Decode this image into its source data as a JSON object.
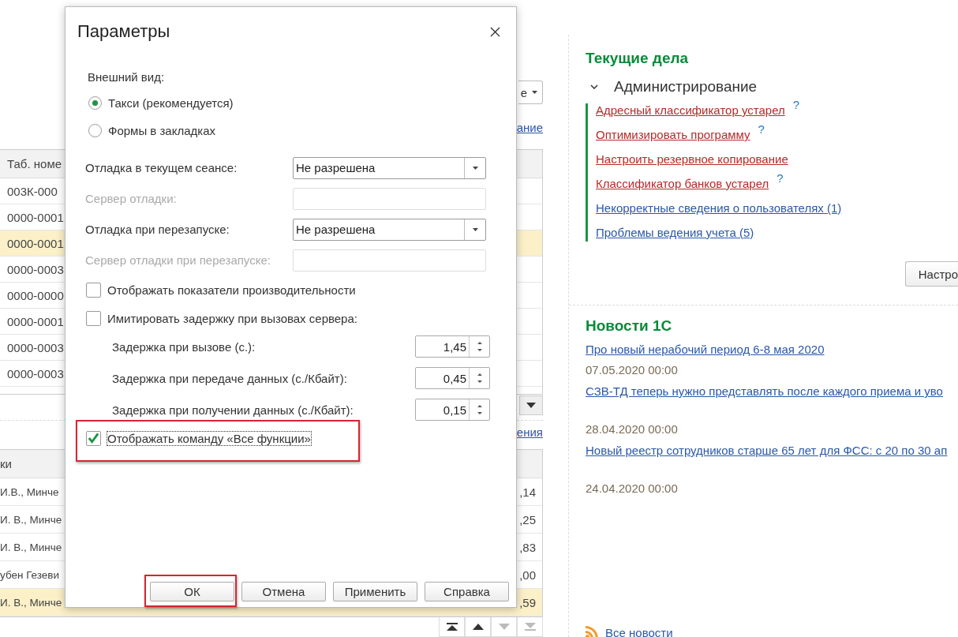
{
  "background": {
    "dropdown_fragment": "е",
    "link_fragment_top": "ание",
    "table_1": {
      "header": "Таб. номе",
      "rows": [
        {
          "cell": "003К-000",
          "selected": false
        },
        {
          "cell": "0000-0001",
          "selected": false
        },
        {
          "cell": "0000-0001",
          "selected": true
        },
        {
          "cell": "0000-0003",
          "selected": false
        },
        {
          "cell": "0000-0000",
          "selected": false
        },
        {
          "cell": "0000-0001",
          "selected": false
        },
        {
          "cell": "0000-0003",
          "selected": false
        },
        {
          "cell": "0000-0003",
          "selected": false
        }
      ]
    },
    "link_fragment_bottom": "ения",
    "table_2": {
      "header": "ки",
      "rows": [
        {
          "cell": "И.В., Минче",
          "amount": ",14",
          "selected": false
        },
        {
          "cell": "И. В., Минче",
          "amount": ",25",
          "selected": false
        },
        {
          "cell": "И. В., Минче",
          "amount": ",83",
          "selected": false
        },
        {
          "cell": "убен Гезеви",
          "amount": ",00",
          "selected": false
        },
        {
          "cell": "И. В., Минче",
          "amount": ",59",
          "selected": true
        }
      ]
    }
  },
  "dialog": {
    "title": "Параметры",
    "appearance_label": "Внешний вид:",
    "radios": [
      {
        "label": "Такси (рекомендуется)",
        "selected": true
      },
      {
        "label": "Формы в закладках",
        "selected": false
      }
    ],
    "fields": [
      {
        "kind": "select",
        "label": "Отладка в текущем сеансе:",
        "value": "Не разрешена",
        "disabled": false
      },
      {
        "kind": "text",
        "label": "Сервер отладки:",
        "disabled": true
      },
      {
        "kind": "select",
        "label": "Отладка при перезапуске:",
        "value": "Не разрешена",
        "disabled": false
      },
      {
        "kind": "text",
        "label": "Сервер отладки при перезапуске:",
        "disabled": true
      }
    ],
    "checkboxes": [
      {
        "label": "Отображать показатели производительности",
        "checked": false
      },
      {
        "label": "Имитировать задержку при вызовах сервера:",
        "checked": false
      }
    ],
    "delays": [
      {
        "label": "Задержка при вызове (с.):",
        "value": "1,45"
      },
      {
        "label": "Задержка при передаче данных (с./Кбайт):",
        "value": "0,45"
      },
      {
        "label": "Задержка при получении данных (с./Кбайт):",
        "value": "0,15"
      }
    ],
    "show_all_functions": {
      "label": "Отображать команду «Все функции»",
      "checked": true,
      "highlighted": true
    },
    "buttons": [
      {
        "label": "ОК",
        "highlighted": true
      },
      {
        "label": "Отмена",
        "highlighted": false
      },
      {
        "label": "Применить",
        "highlighted": false
      },
      {
        "label": "Справка",
        "highlighted": false
      }
    ]
  },
  "right_panel": {
    "current_tasks": {
      "title": "Текущие дела",
      "group": {
        "title": "Администрирование",
        "expanded": true,
        "items": [
          {
            "label": "Адресный классификатор устарел",
            "kind": "warning",
            "help": "?"
          },
          {
            "label": "Оптимизировать программу",
            "kind": "warning",
            "help": "?"
          },
          {
            "label": "Настроить резервное копирование",
            "kind": "warning"
          },
          {
            "label": "Классификатор банков устарел",
            "kind": "warning",
            "help": "?"
          },
          {
            "label": "Некорректные сведения о пользователях (1)",
            "kind": "normal"
          },
          {
            "label": "Проблемы ведения учета (5)",
            "kind": "normal"
          }
        ]
      },
      "settings_button": "Настро"
    },
    "news": {
      "title": "Новости 1С",
      "items": [
        {
          "title": "Про новый нерабочий период 6-8 мая 2020",
          "date": "07.05.2020 00:00"
        },
        {
          "title": "СЗВ-ТД теперь нужно представлять после каждого приема и уво",
          "date": "28.04.2020 00:00"
        },
        {
          "title": "Новый реестр сотрудников старше 65 лет для ФСС: с 20 по 30 ап",
          "date": "24.04.2020 00:00"
        }
      ],
      "all_link": "Все новости"
    }
  }
}
